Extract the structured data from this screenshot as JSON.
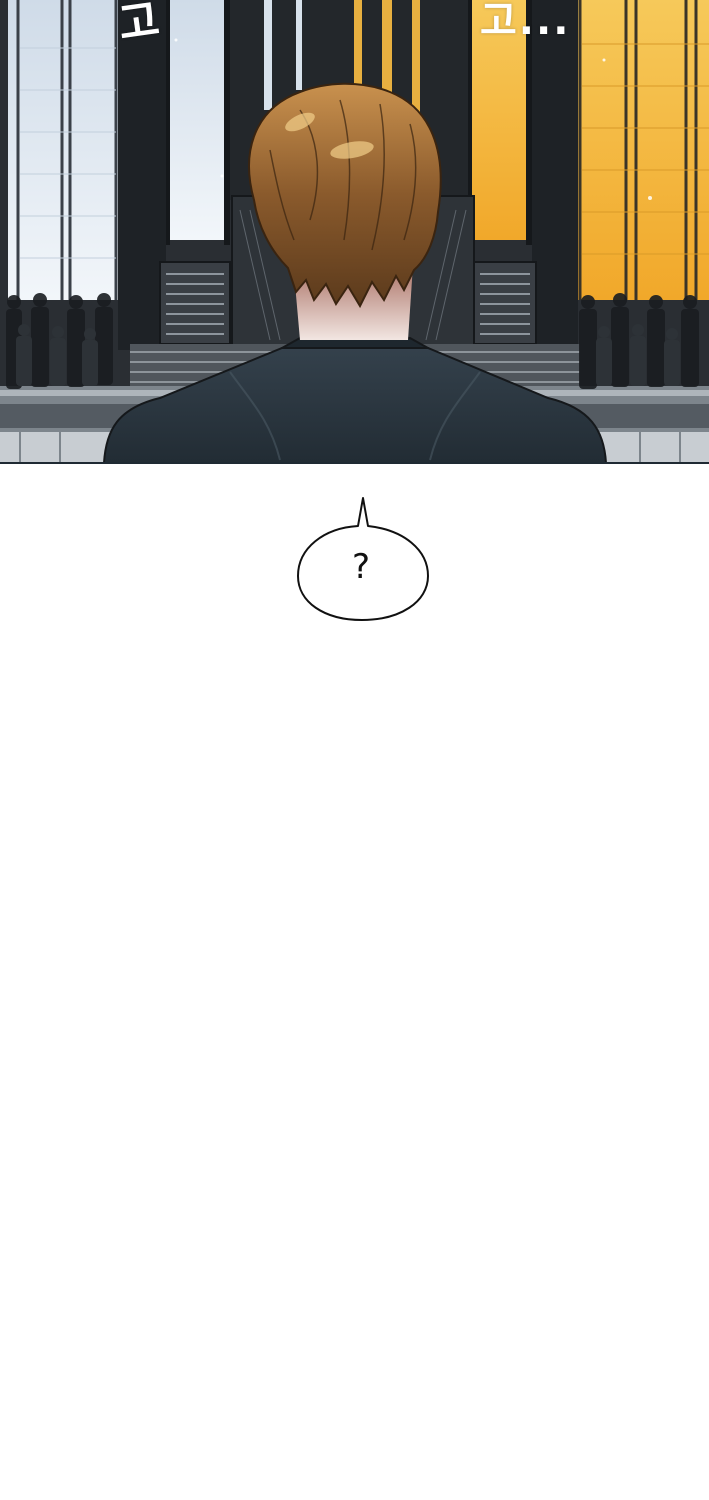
{
  "panel": {
    "sfx_left": "고",
    "sfx_right": "고...",
    "colors": {
      "window_cool": "#dfe9f3",
      "window_warm": "#f3b83a",
      "wall_dark": "#22262a",
      "hair": "#7a5228",
      "suit": "#2c3944"
    }
  },
  "bubble": {
    "text": "?"
  }
}
